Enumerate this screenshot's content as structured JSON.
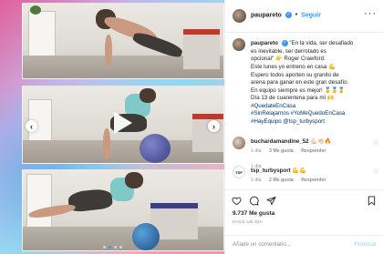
{
  "post": {
    "username": "paupareto",
    "follow_label": "Seguir",
    "separator": "•",
    "caption_user": "paupareto",
    "caption_lines": [
      "\"En la vida, ser desafiado",
      "es inevitable, ser derrotado es",
      "opcional\" 👉 Roger Crawford.",
      "Este lunes yo entreno en casa 💪",
      "Espero todos aporten su granito de",
      "arena para ganar en este gran desafío.",
      "En equipo siempre es mejor! 🥇🥇🥇",
      "Día 13 de cuarentena para mí 🙌"
    ],
    "caption_tags": [
      "#QuedateEnCasa",
      "#SinRelajarnos #YoMeQuedoEnCasa",
      "#HayEquipo @tsp_turbysport"
    ],
    "caption_time": "1 día",
    "comments": [
      {
        "user": "buchardamandine_52",
        "text": "💪🏻👏🏻🔥",
        "time": "1 día",
        "likes": "3 Me gusta",
        "reply": "Responder"
      },
      {
        "user": "tsp_turbysport",
        "avatar_text": "TSP",
        "text": "💪💪",
        "time": "1 día",
        "likes": "2 Me gusta",
        "reply": "Responder"
      }
    ],
    "likes_count": "9.737 Me gusta",
    "date": "HACE UN DÍA",
    "add_comment_placeholder": "Añade un comentario...",
    "publish_label": "Publicar"
  },
  "media": {
    "carousel_dots": 4,
    "active_dot": 1
  },
  "icons": {
    "like": "heart-icon",
    "comment": "comment-icon",
    "share": "share-icon",
    "save": "bookmark-icon",
    "more": "more-options-icon",
    "verified": "verified-badge-icon",
    "play": "play-icon",
    "prev": "chevron-left-icon",
    "next": "chevron-right-icon"
  },
  "colors": {
    "accent": "#3897f0",
    "text": "#262626",
    "muted": "#8e8e8e",
    "publish_disabled": "#b2dffc"
  }
}
